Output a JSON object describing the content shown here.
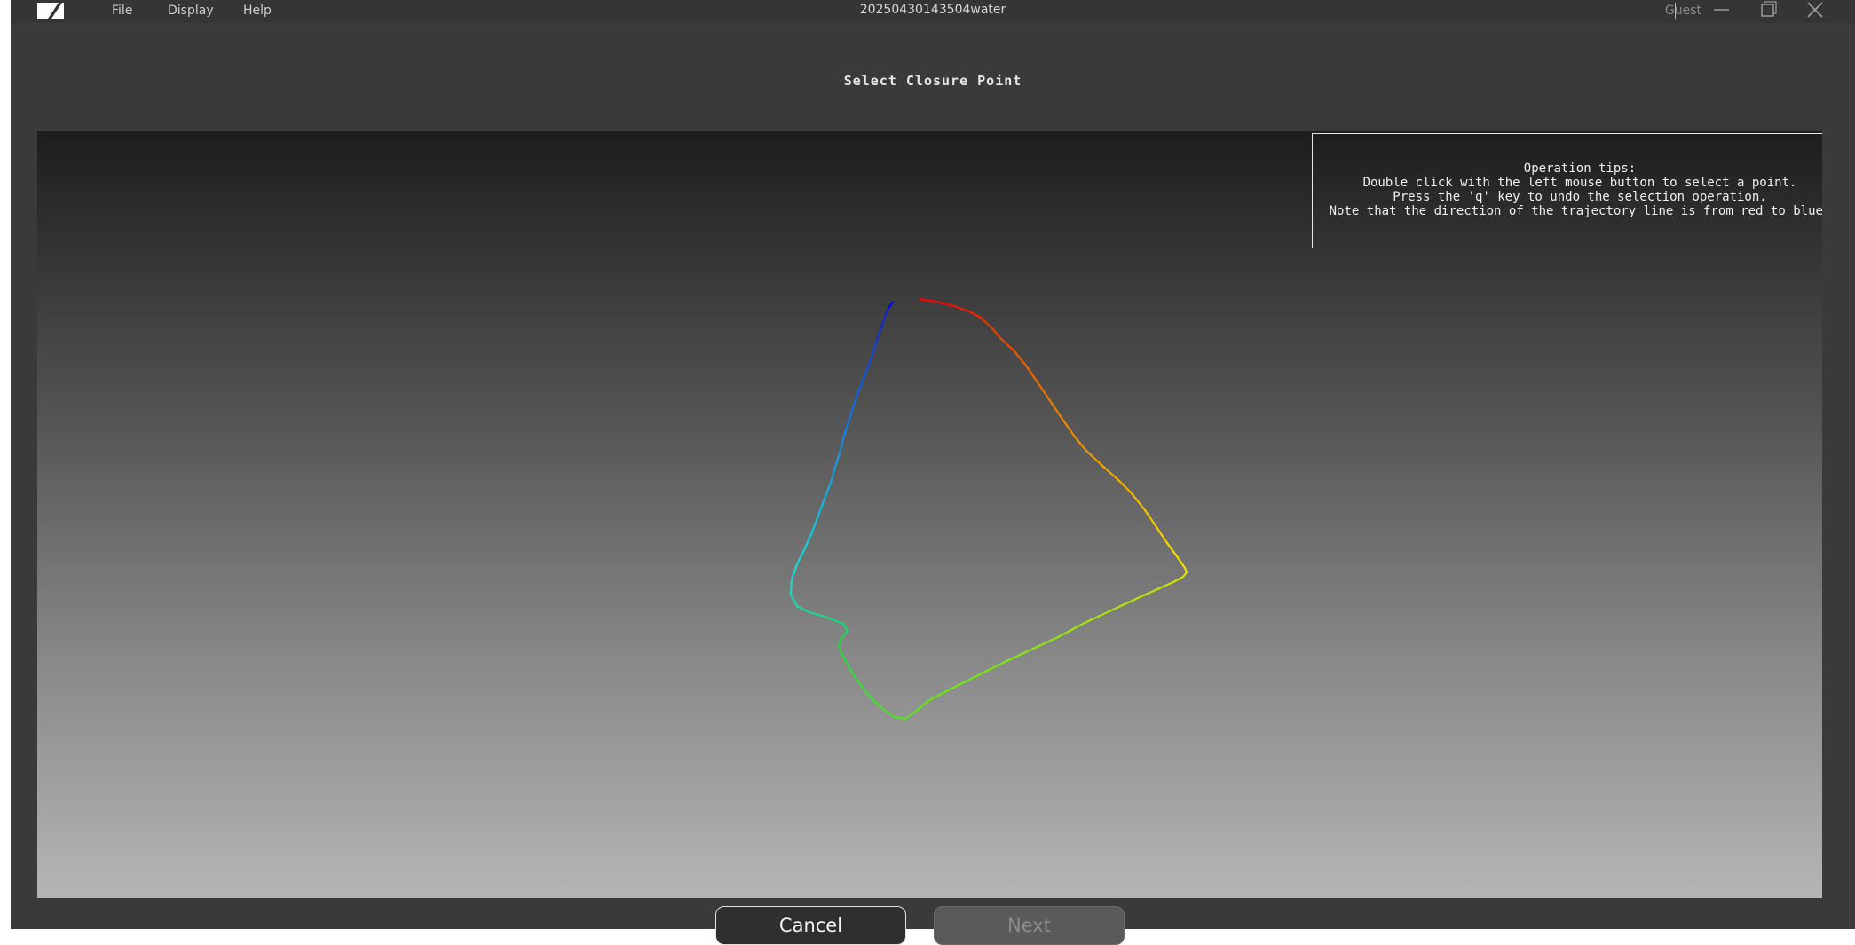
{
  "menu": {
    "file": "File",
    "display": "Display",
    "help": "Help"
  },
  "window": {
    "title": "20250430143504water",
    "user": "Guest"
  },
  "dialog": {
    "title": "Select Closure Point"
  },
  "tips": {
    "heading": "Operation tips:",
    "line1": "Double click with the left mouse button to select a point.",
    "line2": "Press the 'q' key to undo the selection operation.",
    "line3": "Note that the direction of the trajectory line is from red to blue."
  },
  "buttons": {
    "cancel": "Cancel",
    "next": "Next"
  },
  "colors": {
    "trajectory_start": "#ff0000",
    "trajectory_end": "#0000ff"
  },
  "icons": {
    "logo": "app-logo-icon",
    "minimize": "minimize-icon",
    "maximize": "maximize-icon",
    "close": "close-icon"
  }
}
